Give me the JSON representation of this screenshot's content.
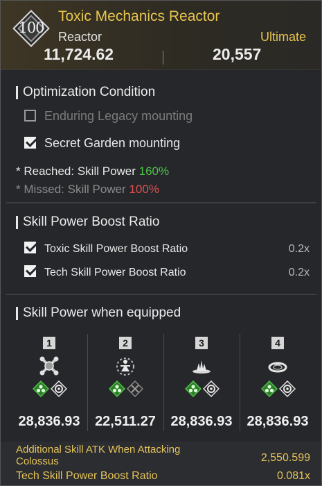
{
  "header": {
    "level": "100",
    "title": "Toxic Mechanics Reactor",
    "subtitle": "Reactor",
    "grade": "Ultimate",
    "stat_left": "11,724.62",
    "stat_right": "20,557"
  },
  "optimization": {
    "title": "Optimization Condition",
    "options": [
      {
        "label": "Enduring Legacy mounting",
        "checked": false
      },
      {
        "label": "Secret Garden mounting",
        "checked": true
      }
    ],
    "reached_prefix": "* Reached: Skill Power ",
    "reached_value": "160%",
    "missed_prefix": "* Missed: Skill Power ",
    "missed_value": "100%"
  },
  "boost": {
    "title": "Skill Power Boost Ratio",
    "rows": [
      {
        "label": "Toxic Skill Power Boost Ratio",
        "value": "0.2x",
        "checked": true
      },
      {
        "label": "Tech Skill Power Boost Ratio",
        "value": "0.2x",
        "checked": true
      }
    ]
  },
  "equipped": {
    "title": "Skill Power when equipped",
    "slots": [
      {
        "index": "1",
        "value": "28,836.93",
        "art_icon": "crossed-tools-icon",
        "attr_icon": "toxic-icon",
        "type_icon": "tech-icon"
      },
      {
        "index": "2",
        "value": "22,511.27",
        "art_icon": "burst-figure-icon",
        "attr_icon": "toxic-icon",
        "type_icon": "tech-muted-icon"
      },
      {
        "index": "3",
        "value": "28,836.93",
        "art_icon": "splash-icon",
        "attr_icon": "toxic-icon",
        "type_icon": "tech-icon"
      },
      {
        "index": "4",
        "value": "28,836.93",
        "art_icon": "ring-disc-icon",
        "attr_icon": "toxic-icon",
        "type_icon": "tech-icon"
      }
    ]
  },
  "footer": {
    "line1_label": "Additional Skill ATK When Attacking",
    "line1_label2": "Colossus",
    "line1_value": "2,550.599",
    "line2_label": "Tech Skill Power Boost Ratio",
    "line2_value": "0.081x"
  },
  "colors": {
    "gold": "#e8c54e",
    "green": "#4fc447",
    "red": "#e05050",
    "panel": "#26272b"
  }
}
